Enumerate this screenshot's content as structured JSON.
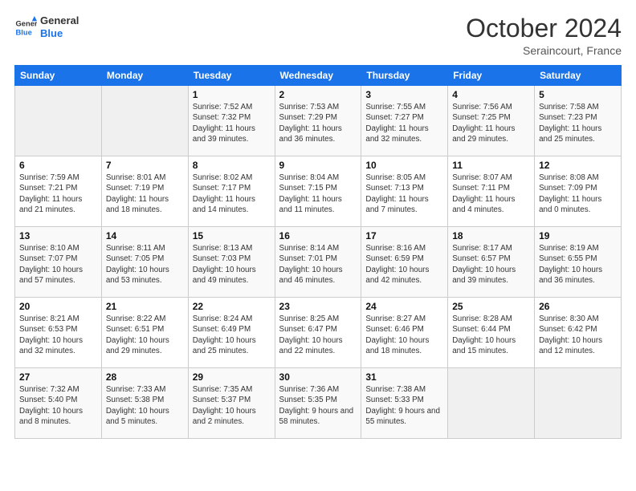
{
  "logo": {
    "line1": "General",
    "line2": "Blue"
  },
  "title": "October 2024",
  "subtitle": "Seraincourt, France",
  "headers": [
    "Sunday",
    "Monday",
    "Tuesday",
    "Wednesday",
    "Thursday",
    "Friday",
    "Saturday"
  ],
  "weeks": [
    [
      {
        "day": "",
        "sunrise": "",
        "sunset": "",
        "daylight": ""
      },
      {
        "day": "",
        "sunrise": "",
        "sunset": "",
        "daylight": ""
      },
      {
        "day": "1",
        "sunrise": "Sunrise: 7:52 AM",
        "sunset": "Sunset: 7:32 PM",
        "daylight": "Daylight: 11 hours and 39 minutes."
      },
      {
        "day": "2",
        "sunrise": "Sunrise: 7:53 AM",
        "sunset": "Sunset: 7:29 PM",
        "daylight": "Daylight: 11 hours and 36 minutes."
      },
      {
        "day": "3",
        "sunrise": "Sunrise: 7:55 AM",
        "sunset": "Sunset: 7:27 PM",
        "daylight": "Daylight: 11 hours and 32 minutes."
      },
      {
        "day": "4",
        "sunrise": "Sunrise: 7:56 AM",
        "sunset": "Sunset: 7:25 PM",
        "daylight": "Daylight: 11 hours and 29 minutes."
      },
      {
        "day": "5",
        "sunrise": "Sunrise: 7:58 AM",
        "sunset": "Sunset: 7:23 PM",
        "daylight": "Daylight: 11 hours and 25 minutes."
      }
    ],
    [
      {
        "day": "6",
        "sunrise": "Sunrise: 7:59 AM",
        "sunset": "Sunset: 7:21 PM",
        "daylight": "Daylight: 11 hours and 21 minutes."
      },
      {
        "day": "7",
        "sunrise": "Sunrise: 8:01 AM",
        "sunset": "Sunset: 7:19 PM",
        "daylight": "Daylight: 11 hours and 18 minutes."
      },
      {
        "day": "8",
        "sunrise": "Sunrise: 8:02 AM",
        "sunset": "Sunset: 7:17 PM",
        "daylight": "Daylight: 11 hours and 14 minutes."
      },
      {
        "day": "9",
        "sunrise": "Sunrise: 8:04 AM",
        "sunset": "Sunset: 7:15 PM",
        "daylight": "Daylight: 11 hours and 11 minutes."
      },
      {
        "day": "10",
        "sunrise": "Sunrise: 8:05 AM",
        "sunset": "Sunset: 7:13 PM",
        "daylight": "Daylight: 11 hours and 7 minutes."
      },
      {
        "day": "11",
        "sunrise": "Sunrise: 8:07 AM",
        "sunset": "Sunset: 7:11 PM",
        "daylight": "Daylight: 11 hours and 4 minutes."
      },
      {
        "day": "12",
        "sunrise": "Sunrise: 8:08 AM",
        "sunset": "Sunset: 7:09 PM",
        "daylight": "Daylight: 11 hours and 0 minutes."
      }
    ],
    [
      {
        "day": "13",
        "sunrise": "Sunrise: 8:10 AM",
        "sunset": "Sunset: 7:07 PM",
        "daylight": "Daylight: 10 hours and 57 minutes."
      },
      {
        "day": "14",
        "sunrise": "Sunrise: 8:11 AM",
        "sunset": "Sunset: 7:05 PM",
        "daylight": "Daylight: 10 hours and 53 minutes."
      },
      {
        "day": "15",
        "sunrise": "Sunrise: 8:13 AM",
        "sunset": "Sunset: 7:03 PM",
        "daylight": "Daylight: 10 hours and 49 minutes."
      },
      {
        "day": "16",
        "sunrise": "Sunrise: 8:14 AM",
        "sunset": "Sunset: 7:01 PM",
        "daylight": "Daylight: 10 hours and 46 minutes."
      },
      {
        "day": "17",
        "sunrise": "Sunrise: 8:16 AM",
        "sunset": "Sunset: 6:59 PM",
        "daylight": "Daylight: 10 hours and 42 minutes."
      },
      {
        "day": "18",
        "sunrise": "Sunrise: 8:17 AM",
        "sunset": "Sunset: 6:57 PM",
        "daylight": "Daylight: 10 hours and 39 minutes."
      },
      {
        "day": "19",
        "sunrise": "Sunrise: 8:19 AM",
        "sunset": "Sunset: 6:55 PM",
        "daylight": "Daylight: 10 hours and 36 minutes."
      }
    ],
    [
      {
        "day": "20",
        "sunrise": "Sunrise: 8:21 AM",
        "sunset": "Sunset: 6:53 PM",
        "daylight": "Daylight: 10 hours and 32 minutes."
      },
      {
        "day": "21",
        "sunrise": "Sunrise: 8:22 AM",
        "sunset": "Sunset: 6:51 PM",
        "daylight": "Daylight: 10 hours and 29 minutes."
      },
      {
        "day": "22",
        "sunrise": "Sunrise: 8:24 AM",
        "sunset": "Sunset: 6:49 PM",
        "daylight": "Daylight: 10 hours and 25 minutes."
      },
      {
        "day": "23",
        "sunrise": "Sunrise: 8:25 AM",
        "sunset": "Sunset: 6:47 PM",
        "daylight": "Daylight: 10 hours and 22 minutes."
      },
      {
        "day": "24",
        "sunrise": "Sunrise: 8:27 AM",
        "sunset": "Sunset: 6:46 PM",
        "daylight": "Daylight: 10 hours and 18 minutes."
      },
      {
        "day": "25",
        "sunrise": "Sunrise: 8:28 AM",
        "sunset": "Sunset: 6:44 PM",
        "daylight": "Daylight: 10 hours and 15 minutes."
      },
      {
        "day": "26",
        "sunrise": "Sunrise: 8:30 AM",
        "sunset": "Sunset: 6:42 PM",
        "daylight": "Daylight: 10 hours and 12 minutes."
      }
    ],
    [
      {
        "day": "27",
        "sunrise": "Sunrise: 7:32 AM",
        "sunset": "Sunset: 5:40 PM",
        "daylight": "Daylight: 10 hours and 8 minutes."
      },
      {
        "day": "28",
        "sunrise": "Sunrise: 7:33 AM",
        "sunset": "Sunset: 5:38 PM",
        "daylight": "Daylight: 10 hours and 5 minutes."
      },
      {
        "day": "29",
        "sunrise": "Sunrise: 7:35 AM",
        "sunset": "Sunset: 5:37 PM",
        "daylight": "Daylight: 10 hours and 2 minutes."
      },
      {
        "day": "30",
        "sunrise": "Sunrise: 7:36 AM",
        "sunset": "Sunset: 5:35 PM",
        "daylight": "Daylight: 9 hours and 58 minutes."
      },
      {
        "day": "31",
        "sunrise": "Sunrise: 7:38 AM",
        "sunset": "Sunset: 5:33 PM",
        "daylight": "Daylight: 9 hours and 55 minutes."
      },
      {
        "day": "",
        "sunrise": "",
        "sunset": "",
        "daylight": ""
      },
      {
        "day": "",
        "sunrise": "",
        "sunset": "",
        "daylight": ""
      }
    ]
  ]
}
